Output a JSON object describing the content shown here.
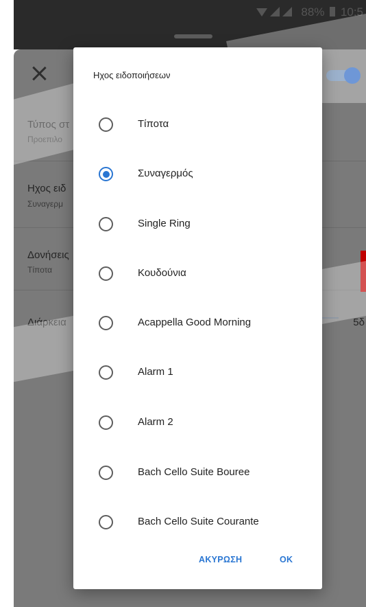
{
  "status_bar": {
    "battery": "88%",
    "time": "10:5"
  },
  "sheet": {
    "rows": [
      {
        "title": "Τύπος στ",
        "subtitle": "Προεπιλο"
      },
      {
        "title": "Ηχος ειδ",
        "subtitle": "Συναγερμ"
      },
      {
        "title": "Δονήσεις",
        "subtitle": "Τίποτα"
      },
      {
        "title": "Διάρκεια",
        "value": "5δ"
      }
    ]
  },
  "dialog": {
    "title": "Ηχος ειδοποιήσεων",
    "selected": "Συναγερμός",
    "options": [
      "Τίποτα",
      "Συναγερμός",
      "Single Ring",
      "Κουδούνια",
      "Acappella Good Morning",
      "Alarm 1",
      "Alarm 2",
      "Bach Cello Suite Bouree",
      "Bach Cello Suite Courante"
    ],
    "cancel_label": "ΑΚΥΡΩΣΗ",
    "ok_label": "OK"
  },
  "colors": {
    "accent": "#2a76d2",
    "scrim": "#7a7a7a",
    "status_bar": "#2a2a2a"
  }
}
